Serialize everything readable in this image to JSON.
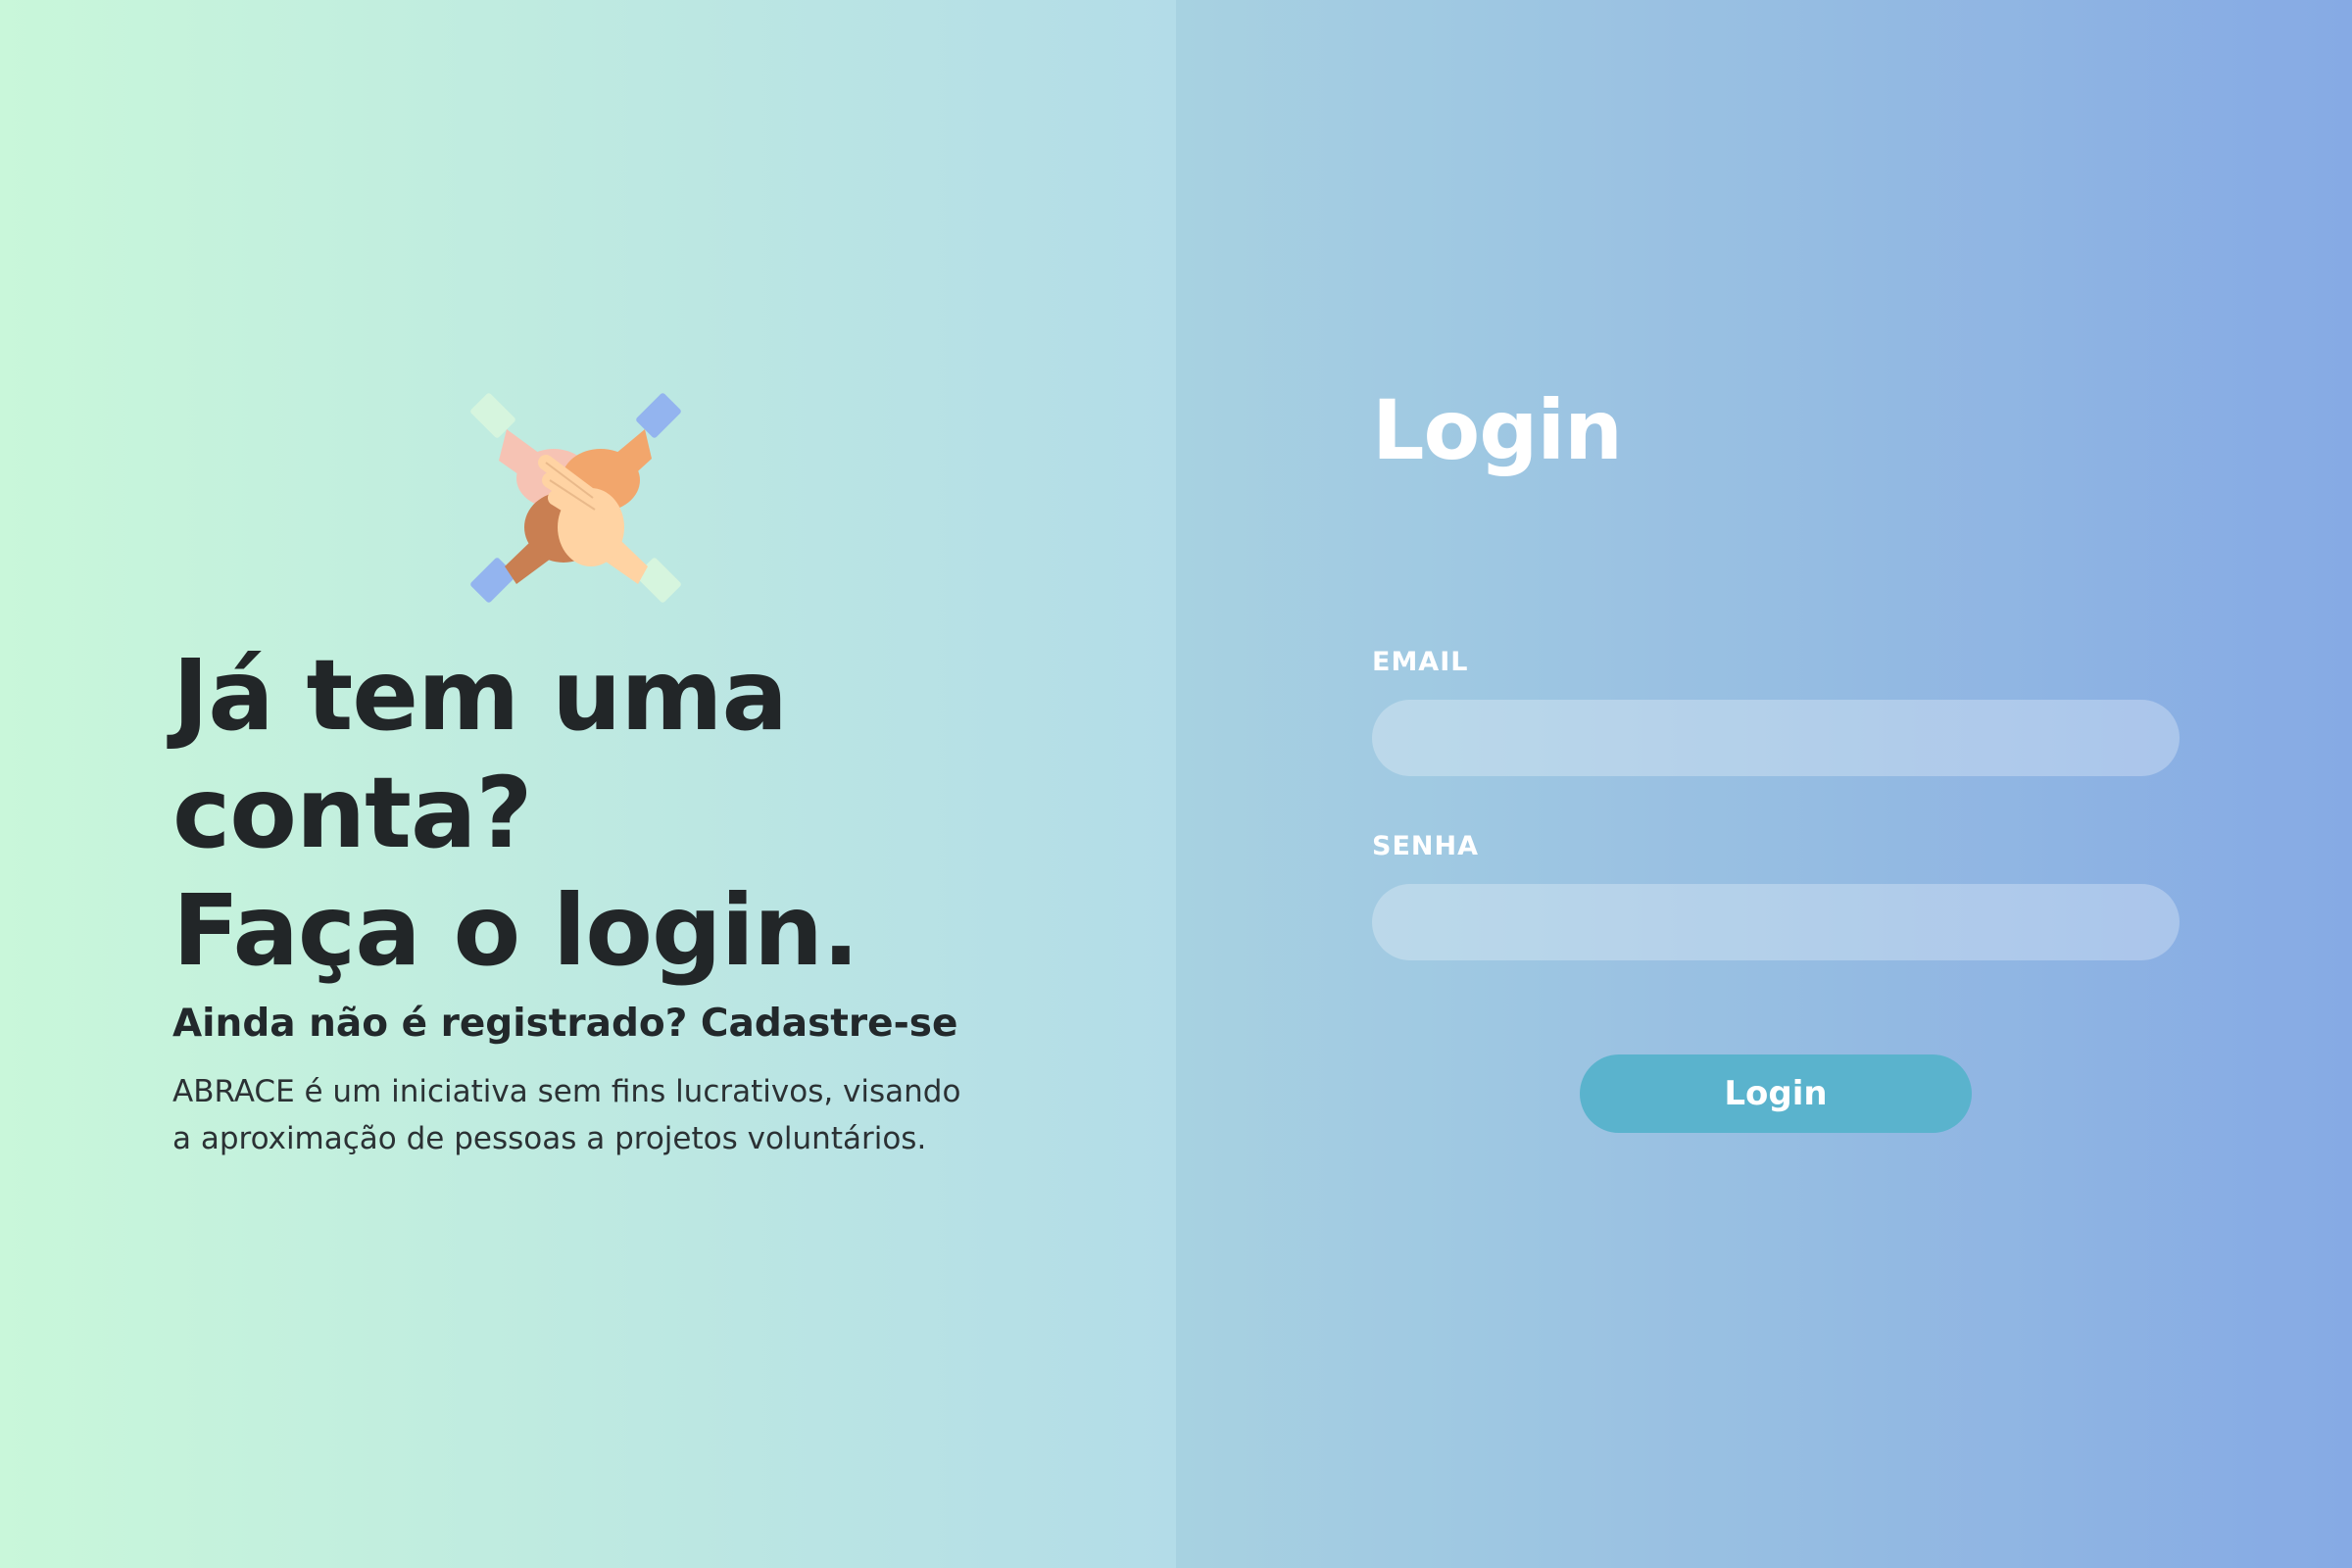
{
  "hero": {
    "headline_line1": "Já tem uma",
    "headline_line2": "conta?",
    "headline_line3": "Faça o login.",
    "register_prompt": "Ainda não é registrado? Cadastre-se",
    "description_line1": "ABRACE é um iniciativa sem fins lucrativos, visando",
    "description_line2": "a aproximação de pessoas a projetos voluntários.",
    "logo_icon": "stacked-hands-icon"
  },
  "login": {
    "title": "Login",
    "email_label": "EMAIL",
    "email_value": "",
    "senha_label": "SENHA",
    "senha_value": "",
    "button_label": "Login"
  },
  "colors": {
    "gradient_start": "#c9f7da",
    "gradient_mid": "#b3dce8",
    "gradient_end": "#8eb0ec",
    "button": "#5ab3cd",
    "heading_text": "#222628"
  }
}
